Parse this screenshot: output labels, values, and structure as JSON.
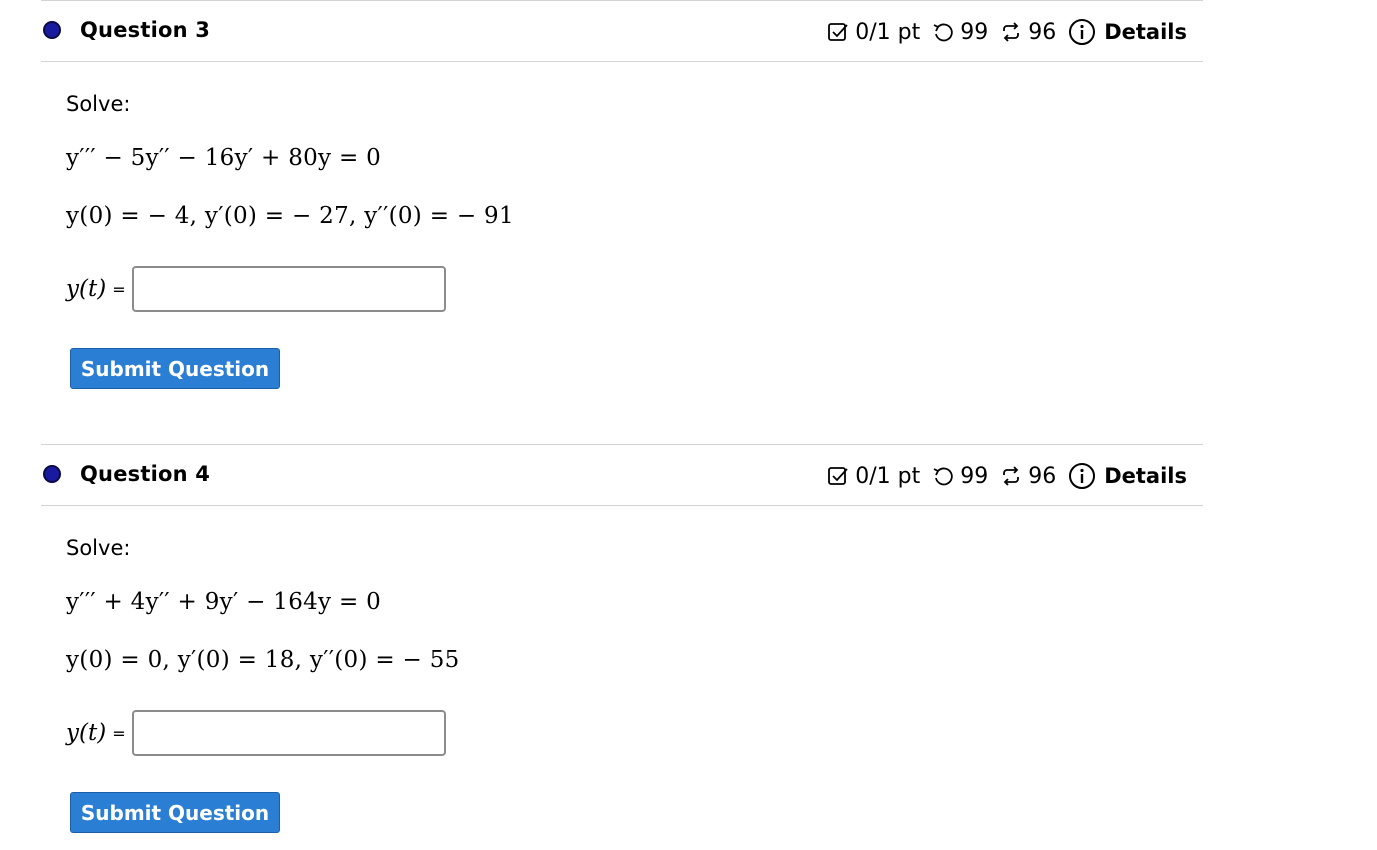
{
  "questions": [
    {
      "title": "Question 3",
      "points": "0/1 pt",
      "retries": "99",
      "attempts": "96",
      "details": "Details",
      "prompt": "Solve:",
      "equation": "y′′′ − 5y′′ − 16y′ + 80y = 0",
      "conditions": "y(0) = − 4,  y′(0) = − 27,  y′′(0) = − 91",
      "answer_label": "y(t)",
      "answer_equals": "=",
      "answer_value": "",
      "submit_label": "Submit Question"
    },
    {
      "title": "Question 4",
      "points": "0/1 pt",
      "retries": "99",
      "attempts": "96",
      "details": "Details",
      "prompt": "Solve:",
      "equation": "y′′′ + 4y′′ + 9y′ − 164y = 0",
      "conditions": "y(0) = 0,  y′(0) = 18,  y′′(0) = − 55",
      "answer_label": "y(t)",
      "answer_equals": "=",
      "answer_value": "",
      "submit_label": "Submit Question"
    }
  ],
  "colors": {
    "status_dot": "#1a1aa0",
    "submit_button": "#2a7fd4",
    "divider": "#d3d3d3"
  },
  "icons": {
    "points": "checkbox-icon",
    "retries": "undo-icon",
    "attempts": "retry-arrows-icon",
    "details": "info-circle-icon"
  }
}
